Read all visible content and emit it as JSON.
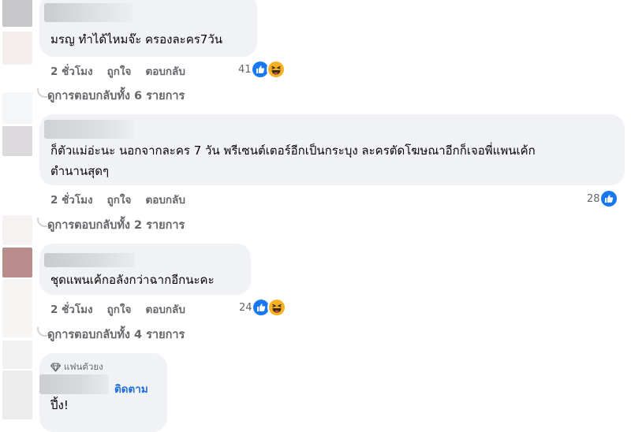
{
  "colors": {
    "bubble": "#f0f2f5",
    "meta_text": "#65676b",
    "like_blue": "#1877f2",
    "haha_yellow": "#f7b125",
    "follow_blue": "#216fdb"
  },
  "comments": [
    {
      "text": "มรญ ทำได้ไหมจ๊ะ ครองละคร7วัน",
      "time": "2 ชั่วโมง",
      "like_label": "ถูกใจ",
      "reply_label": "ตอบกลับ",
      "reaction_count": "41",
      "reactions": [
        "like-icon",
        "haha-icon"
      ],
      "view_replies": "ดูการตอบกลับทั้ง 6 รายการ"
    },
    {
      "text_line1": "ก็ตัวแม่อ่ะนะ นอกจากละคร 7 วัน พรีเซนต์เตอร์อีกเป็นกระบุง ละครตัดโฆษณาอีกก็เจอพี่แพนเค้ก",
      "text_line2": "ตำนานสุดๆ",
      "time": "2 ชั่วโมง",
      "like_label": "ถูกใจ",
      "reply_label": "ตอบกลับ",
      "reaction_count": "28",
      "reactions": [
        "like-icon"
      ],
      "view_replies": "ดูการตอบกลับทั้ง 2 รายการ"
    },
    {
      "text": "ชุดแพนเค้กอลังกว่าฉากอีกนะคะ",
      "time": "2 ชั่วโมง",
      "like_label": "ถูกใจ",
      "reply_label": "ตอบกลับ",
      "reaction_count": "24",
      "reactions": [
        "like-icon",
        "haha-icon"
      ],
      "view_replies": "ดูการตอบกลับทั้ง 4 รายการ"
    },
    {
      "badge": "แฟนตัวยง",
      "follow_label": "ติดตาม",
      "text": "ปึ้ง!"
    }
  ]
}
